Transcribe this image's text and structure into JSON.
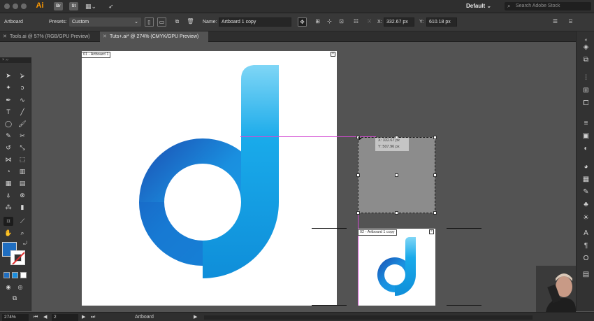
{
  "menubar": {
    "app_logo": "Ai",
    "bridge_btn": "Br",
    "stock_btn": "St",
    "workspace": "Default ⌄",
    "stock_search_placeholder": "Search Adobe Stock"
  },
  "controlbar": {
    "tool_name": "Artboard",
    "presets_label": "Presets:",
    "presets_value": "Custom",
    "name_label": "Name:",
    "name_value": "Artboard 1 copy",
    "x_label": "X:",
    "x_value": "332.67 px",
    "y_label": "Y:",
    "y_value": "610.18 px"
  },
  "tabs": [
    {
      "label": "Tools.ai @ 57% (RGB/GPU Preview)",
      "active": false
    },
    {
      "label": "Tuts+.ai* @ 274% (CMYK/GPU Preview)",
      "active": true
    }
  ],
  "artboards": [
    {
      "label": "01 - Artboard 1"
    },
    {
      "label": "02 - Artboard 1 copy"
    }
  ],
  "tooltip": {
    "x": "X: 332.67 px",
    "y": "Y: 507.96 px"
  },
  "statusbar": {
    "zoom": "274%",
    "artboard_index": "2",
    "tool_status": "Artboard"
  },
  "colors": {
    "fill": "#1f6ec1",
    "logo_light": "#6fd0f4",
    "logo_mid": "#1aa7e8",
    "logo_dark": "#1b4fb0",
    "guide": "#d24bd2",
    "accent_orange": "#ff9a00"
  }
}
